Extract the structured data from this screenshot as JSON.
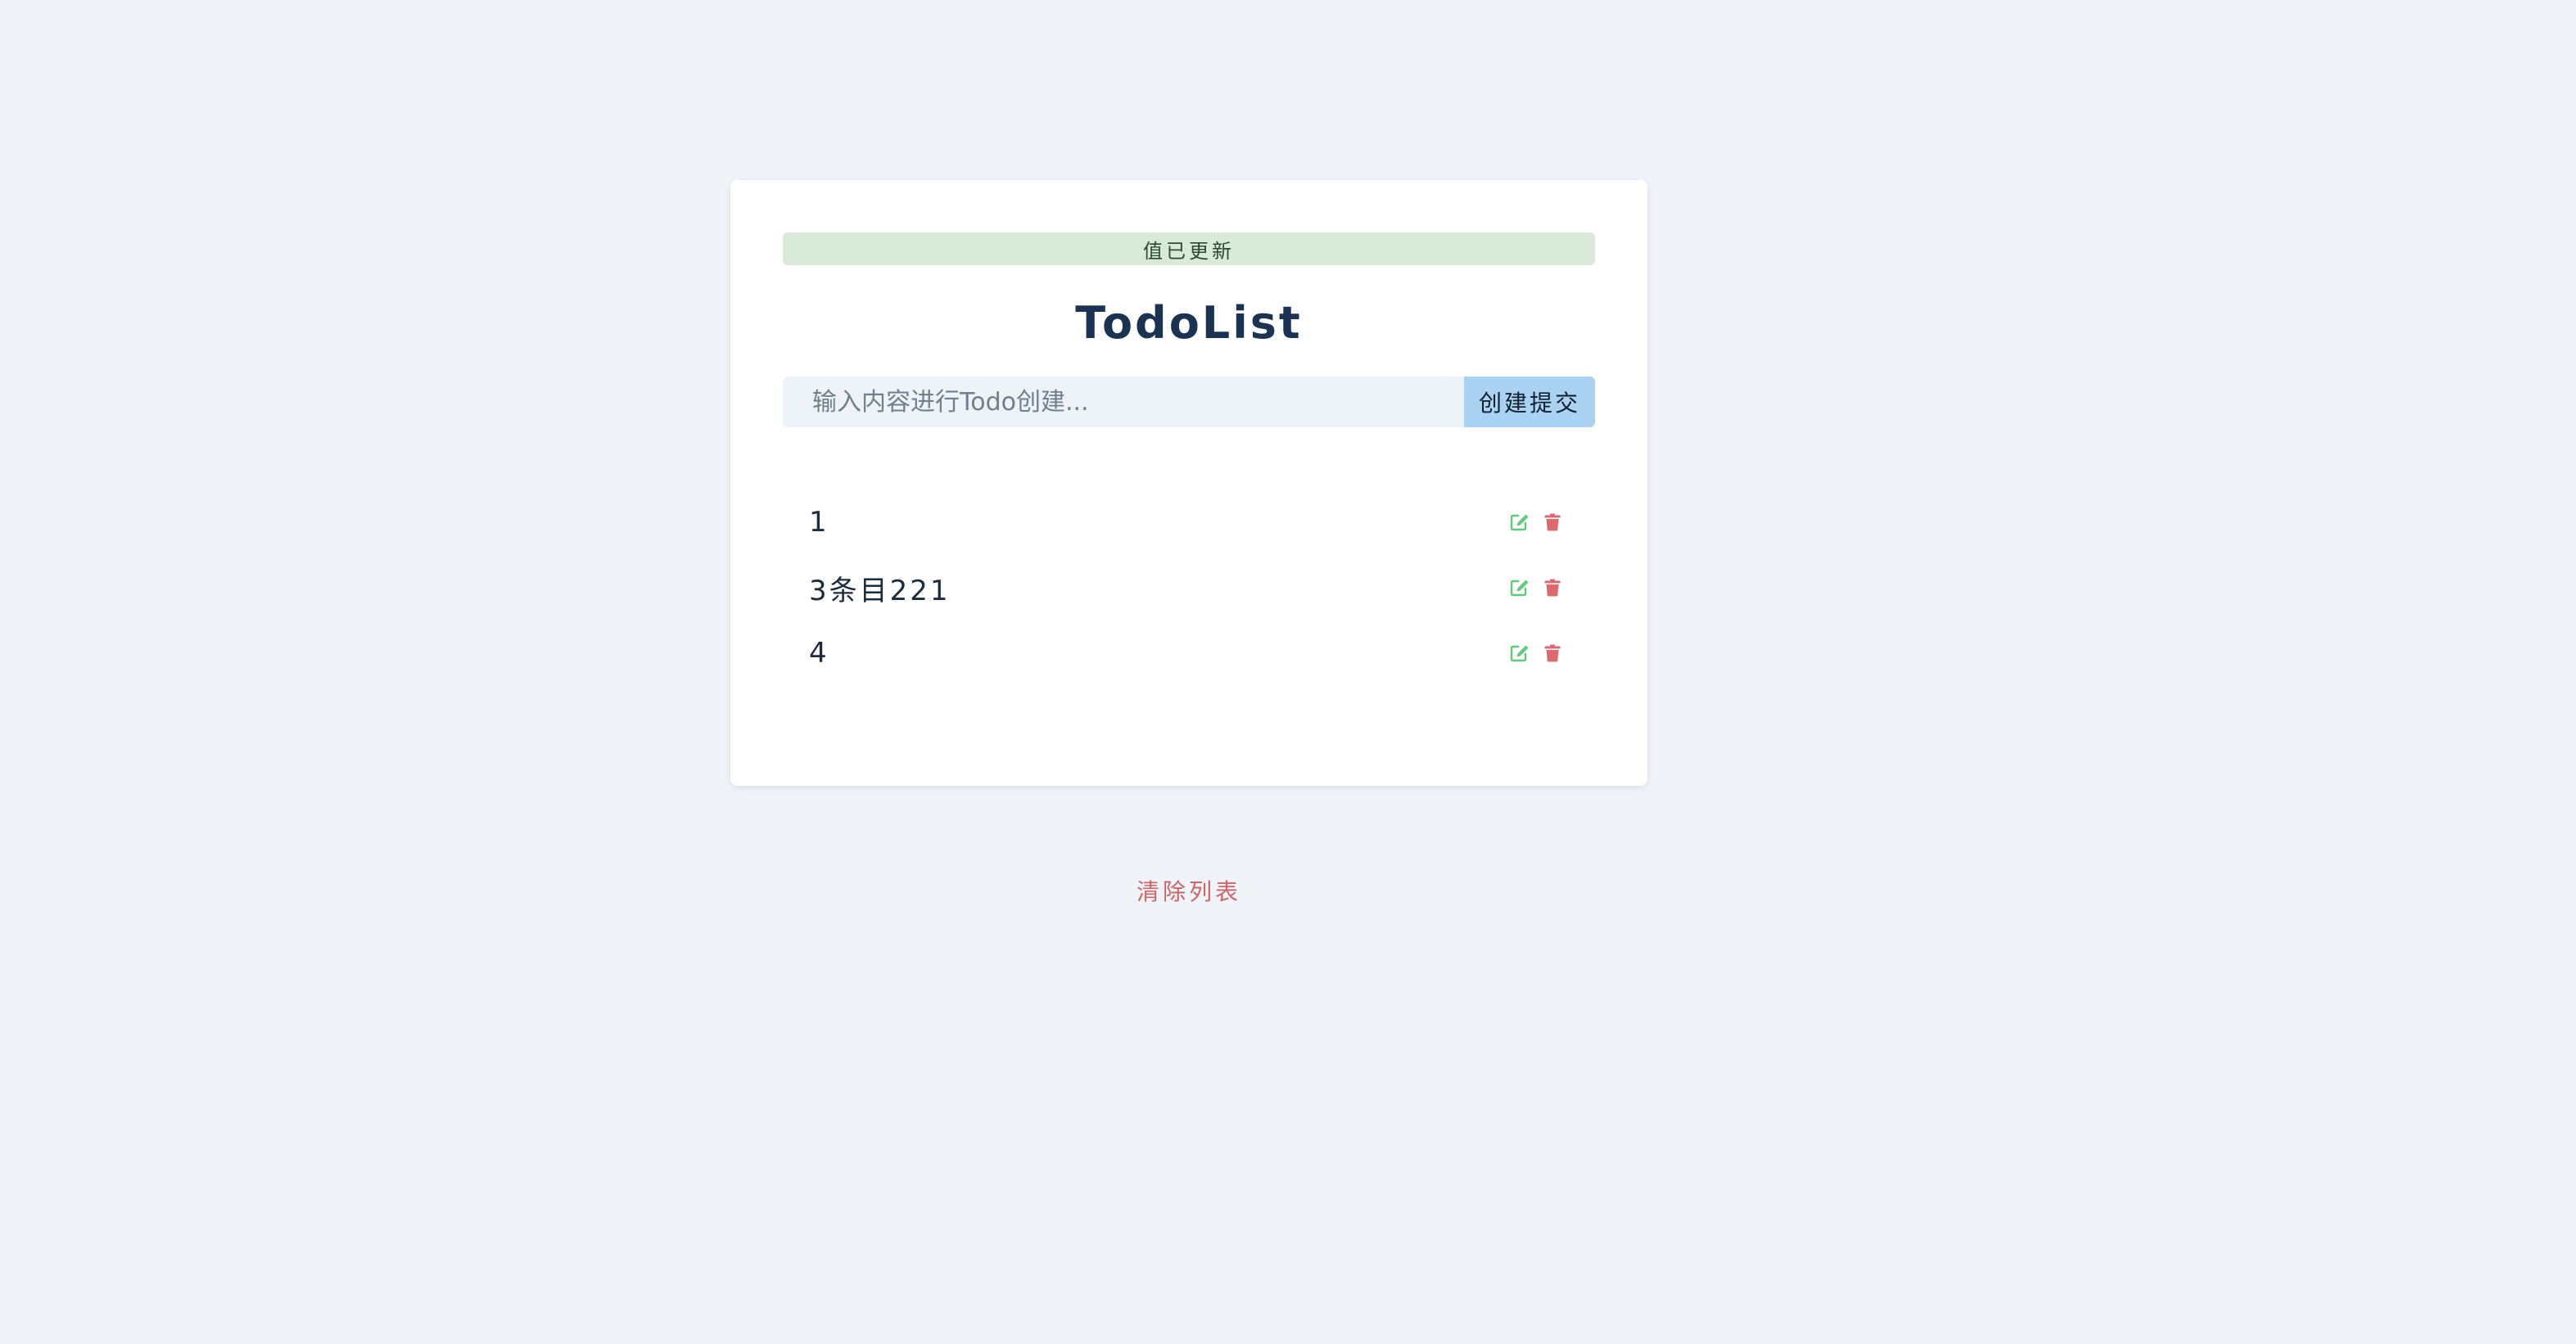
{
  "alert": {
    "text": "值已更新"
  },
  "header": {
    "title": "TodoList"
  },
  "form": {
    "placeholder": "输入内容进行Todo创建...",
    "value": "",
    "submit_label": "创建提交"
  },
  "todos": [
    {
      "text": "1",
      "edit_icon": "edit-icon",
      "delete_icon": "trash-icon"
    },
    {
      "text": "3条目221",
      "edit_icon": "edit-icon",
      "delete_icon": "trash-icon"
    },
    {
      "text": "4",
      "edit_icon": "edit-icon",
      "delete_icon": "trash-icon"
    }
  ],
  "footer": {
    "clear_label": "清除列表"
  },
  "colors": {
    "background": "#f0f4f8",
    "alert_bg": "#d9ead9",
    "title": "#1b3352",
    "submit_bg": "#a9d2f3",
    "edit_icon": "#5fcc78",
    "delete_icon": "#d96b6d",
    "clear_text": "#cf6467"
  }
}
